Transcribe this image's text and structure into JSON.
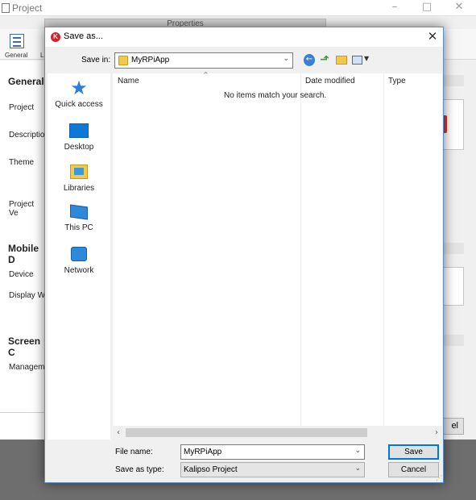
{
  "background_window": {
    "title": "Project",
    "properties_tab": "Properties",
    "toolbar": {
      "general_label": "General",
      "l_label": "L"
    },
    "sections": [
      "General",
      "Mobile D",
      "Screen C"
    ],
    "labels": [
      "Project",
      "Descriptio",
      "Theme",
      "Project Ve",
      "Device",
      "Display W",
      "Managem"
    ],
    "cancel_fragment": "el"
  },
  "dialog": {
    "title": "Save as...",
    "logo_letter": "K",
    "save_in_label": "Save in:",
    "save_in_value": "MyRPiApp",
    "places": [
      "Quick access",
      "Desktop",
      "Libraries",
      "This PC",
      "Network"
    ],
    "columns": [
      "Name",
      "Date modified",
      "Type"
    ],
    "empty_message": "No items match your search.",
    "file_name_label": "File name:",
    "file_name_value": "MyRPiApp",
    "save_as_type_label": "Save as type:",
    "save_as_type_value": "Kalipso Project",
    "save_button": "Save",
    "cancel_button": "Cancel"
  },
  "colors": {
    "accent": "#0078d7",
    "logo_red": "#d61f26",
    "folder_yellow": "#f2c94c"
  }
}
